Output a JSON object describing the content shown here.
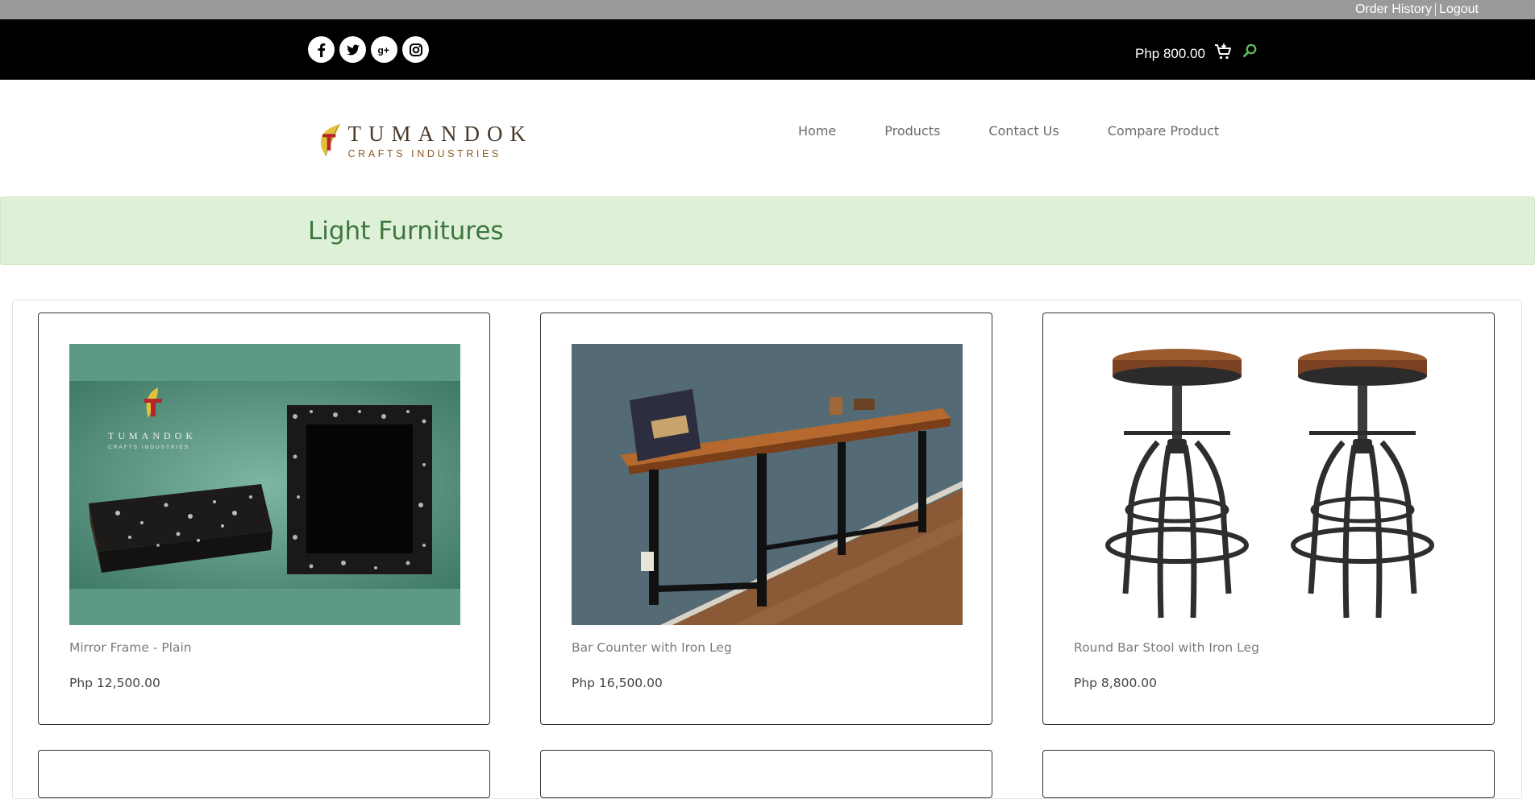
{
  "utility": {
    "order_history": "Order History",
    "logout": "Logout"
  },
  "header": {
    "social_icons": [
      "facebook-icon",
      "twitter-icon",
      "google-plus-icon",
      "instagram-icon"
    ],
    "cart_total": "Php 800.00",
    "cart_icon": "cart-icon",
    "search_icon": "search-icon",
    "accent_color": "#5cb85c"
  },
  "logo": {
    "brand": "TUMANDOK",
    "sub": "CRAFTS INDUSTRIES"
  },
  "nav": {
    "items": [
      "Home",
      "Products",
      "Contact Us",
      "Compare Product"
    ]
  },
  "banner": {
    "title": "Light Furnitures",
    "background": "#dff0d8",
    "text_color": "#3c763d"
  },
  "products": [
    {
      "name": "Mirror Frame - Plain",
      "price": "Php 12,500.00"
    },
    {
      "name": "Bar Counter with Iron Leg",
      "price": "Php 16,500.00"
    },
    {
      "name": "Round Bar Stool with Iron Leg",
      "price": "Php 8,800.00"
    }
  ]
}
